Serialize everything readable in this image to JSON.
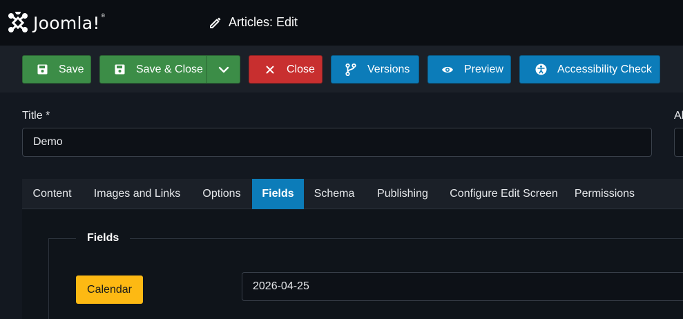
{
  "header": {
    "brand": "Joomla!",
    "brand_mark": "®",
    "title": "Articles: Edit",
    "title_icon": "pencil-icon"
  },
  "toolbar": {
    "save": {
      "label": "Save",
      "icon": "floppy-disk-icon",
      "color": "#3c8d47"
    },
    "save_close": {
      "label": "Save & Close",
      "icon": "floppy-disk-icon",
      "dropdown_icon": "chevron-down-icon",
      "color": "#3c8d47"
    },
    "close": {
      "label": "Close",
      "icon": "close-icon",
      "color": "#c82f2f"
    },
    "versions": {
      "label": "Versions",
      "icon": "code-branch-icon",
      "color": "#0c7cb9"
    },
    "preview": {
      "label": "Preview",
      "icon": "eye-icon",
      "color": "#0c7cb9"
    },
    "accessibility": {
      "label": "Accessibility Check",
      "icon": "universal-access-icon",
      "color": "#0c7cb9"
    }
  },
  "form": {
    "title_label": "Title *",
    "title_value": "Demo",
    "alias_label": "Al"
  },
  "tabs": {
    "items": [
      {
        "label": "Content"
      },
      {
        "label": "Images and Links"
      },
      {
        "label": "Options"
      },
      {
        "label": "Fields"
      },
      {
        "label": "Schema"
      },
      {
        "label": "Publishing"
      },
      {
        "label": "Configure Edit Screen"
      },
      {
        "label": "Permissions"
      }
    ],
    "active": "Fields"
  },
  "fields_panel": {
    "legend": "Fields",
    "calendar_label": "Calendar",
    "calendar_value": "2026-04-25"
  },
  "colors": {
    "header_bg": "#0b0e13",
    "toolbar_bg": "#1b2028",
    "page_bg": "#131820",
    "active_tab": "#0c7cb9",
    "badge": "#fdb913"
  }
}
